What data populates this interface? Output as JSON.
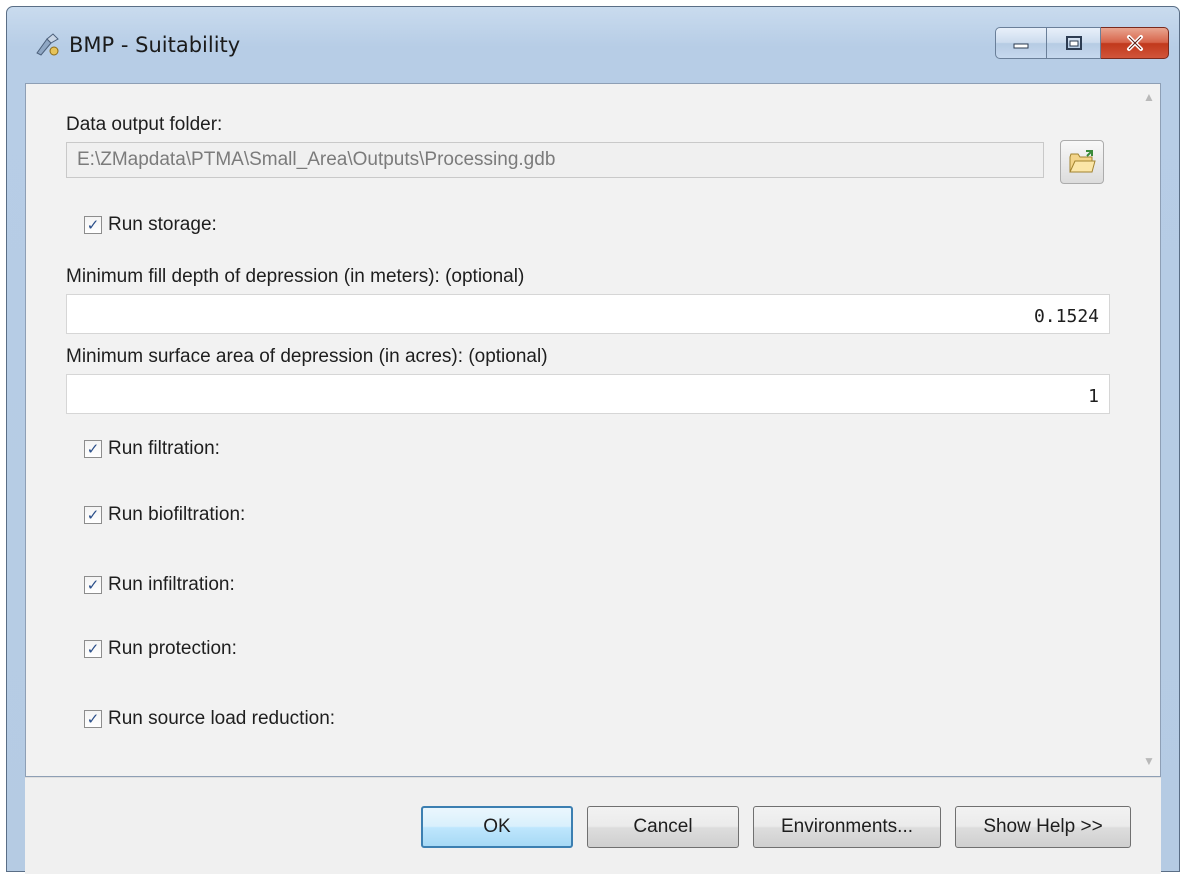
{
  "window": {
    "title": "BMP - Suitability"
  },
  "form": {
    "output_folder_label": "Data output folder:",
    "output_folder_value": "E:\\ZMapdata\\PTMA\\Small_Area\\Outputs\\Processing.gdb",
    "run_storage_label": "Run storage:",
    "min_fill_depth_label": "Minimum fill depth of depression (in meters): (optional)",
    "min_fill_depth_value": "0.1524",
    "min_surface_area_label": "Minimum surface area of depression (in acres): (optional)",
    "min_surface_area_value": "1",
    "run_filtration_label": "Run filtration:",
    "run_biofiltration_label": "Run biofiltration:",
    "run_infiltration_label": "Run infiltration:",
    "run_protection_label": "Run protection:",
    "run_source_load_label": "Run source load reduction:",
    "checkmark": "✓"
  },
  "buttons": {
    "ok": "OK",
    "cancel": "Cancel",
    "environments": "Environments...",
    "show_help": "Show Help >>"
  },
  "scroll": {
    "up_arrow": "▲",
    "down_arrow": "▼"
  },
  "colors": {
    "titlebar": "#b7cde6",
    "close_button": "#c1391c",
    "default_button_border": "#3c7fb1"
  }
}
